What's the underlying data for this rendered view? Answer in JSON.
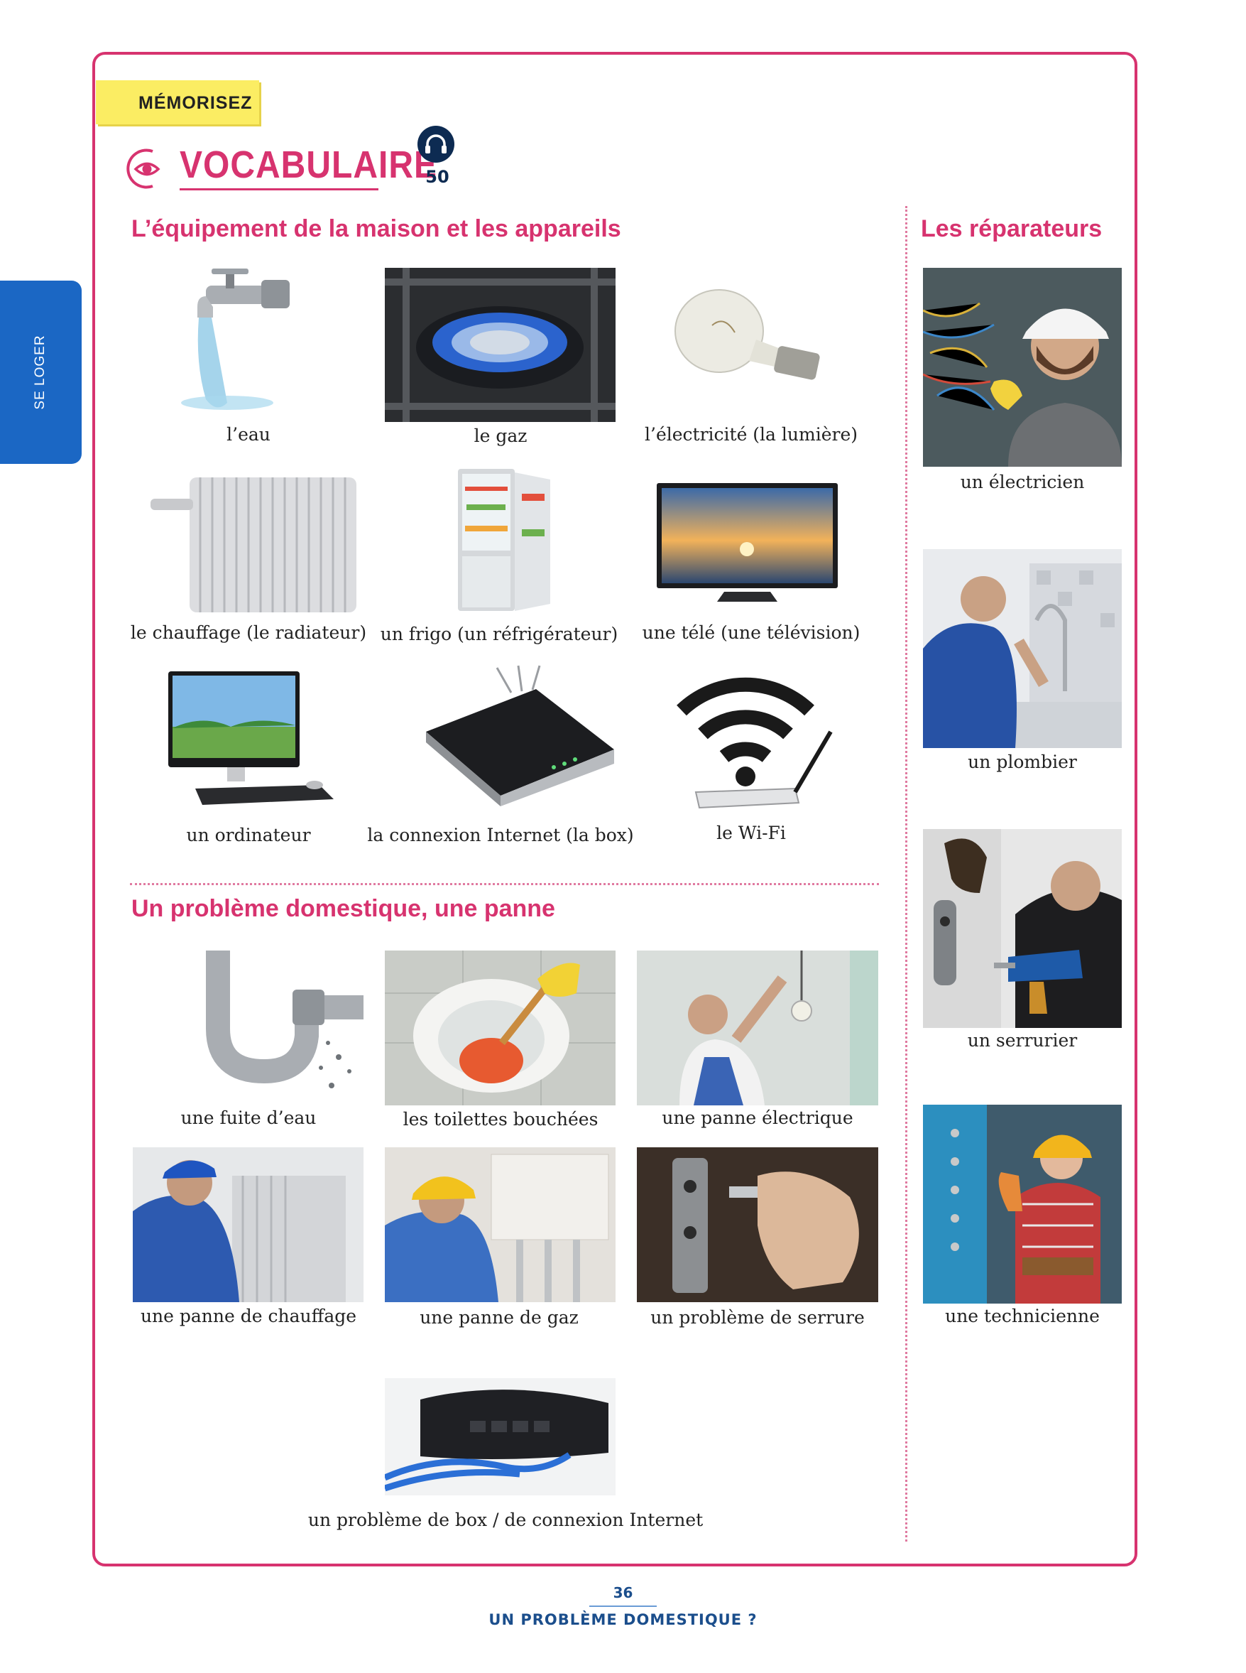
{
  "side_tab": "SE LOGER",
  "tag": "MÉMORISEZ",
  "heading": {
    "title": "VOCABULAIRE",
    "track": "50"
  },
  "sections": {
    "equipment": "L’équipement de la maison et les appareils",
    "repairers": "Les réparateurs",
    "problem": "Un problème domestique, une panne"
  },
  "equipment_items": [
    "l’eau",
    "le gaz",
    "l’électricité (la lumière)",
    "le chauffage (le radiateur)",
    "un frigo (un réfrigérateur)",
    "une télé (une télévision)",
    "un ordinateur",
    "la connexion Internet (la box)",
    "le Wi-Fi"
  ],
  "problem_items": [
    "une fuite d’eau",
    "les toilettes bouchées",
    "une panne électrique",
    "une panne de chauffage",
    "une panne de gaz",
    "un problème de serrure",
    "un problème de box / de connexion Internet"
  ],
  "repairer_items": [
    "un électricien",
    "un plombier",
    "un serrurier",
    "une technicienne"
  ],
  "footer": {
    "page": "36",
    "title": "UN PROBLÈME DOMESTIQUE ?"
  }
}
